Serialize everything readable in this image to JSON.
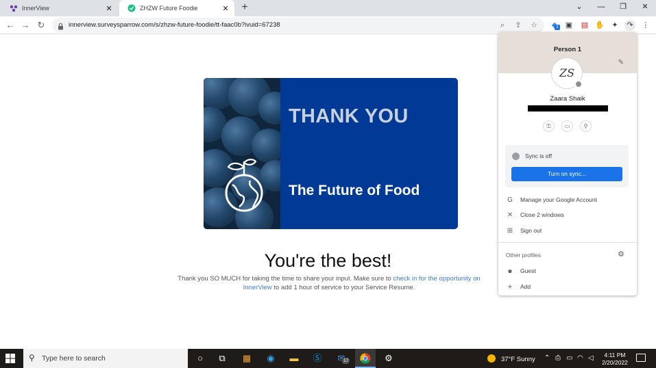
{
  "browser": {
    "tabs": [
      {
        "title": "InnerView",
        "active": false
      },
      {
        "title": "ZHZW Future Foodie",
        "active": true
      }
    ],
    "new_tab_icon": "+",
    "url": "innerview.surveysparrow.com/s/zhzw-future-foodie/tt-faac0b?ivuid=67238",
    "window_controls": [
      "chevron-down-icon",
      "minimize-icon",
      "restore-icon",
      "close-icon"
    ],
    "extension_badge": "1"
  },
  "page": {
    "hero": {
      "line1": "THANK YOU",
      "line2": "The Future of Food"
    },
    "heading": "You're the best!",
    "message_part1": "Thank you SO MUCH for taking the time to share your input. Make sure to ",
    "message_link": "check in for the opportunity on InnerView",
    "message_part2": " to add 1 hour of service to your Service Resume.",
    "colors": {
      "hero_bg": "#003a96",
      "link": "#3a7bd5"
    }
  },
  "profile_menu": {
    "profile_label": "Person 1",
    "user_name": "Zaara Shaik",
    "avatar_text": "ZS",
    "sync_status": "Sync is off",
    "sync_button": "Turn on sync...",
    "items": [
      {
        "icon": "google-icon",
        "glyph": "G",
        "label": "Manage your Google Account"
      },
      {
        "icon": "close-icon",
        "glyph": "✕",
        "label": "Close 2 windows"
      },
      {
        "icon": "sign-out-icon",
        "glyph": "⊞",
        "label": "Sign out"
      }
    ],
    "other_profiles_label": "Other profiles",
    "other_profiles": [
      {
        "icon": "guest-icon",
        "glyph": "●",
        "label": "Guest"
      },
      {
        "icon": "add-icon",
        "glyph": "+",
        "label": "Add"
      }
    ]
  },
  "taskbar": {
    "search_placeholder": "Type here to search",
    "weather": "37°F  Sunny",
    "time": "4:11 PM",
    "date": "2/20/2022",
    "mail_badge": "17"
  }
}
